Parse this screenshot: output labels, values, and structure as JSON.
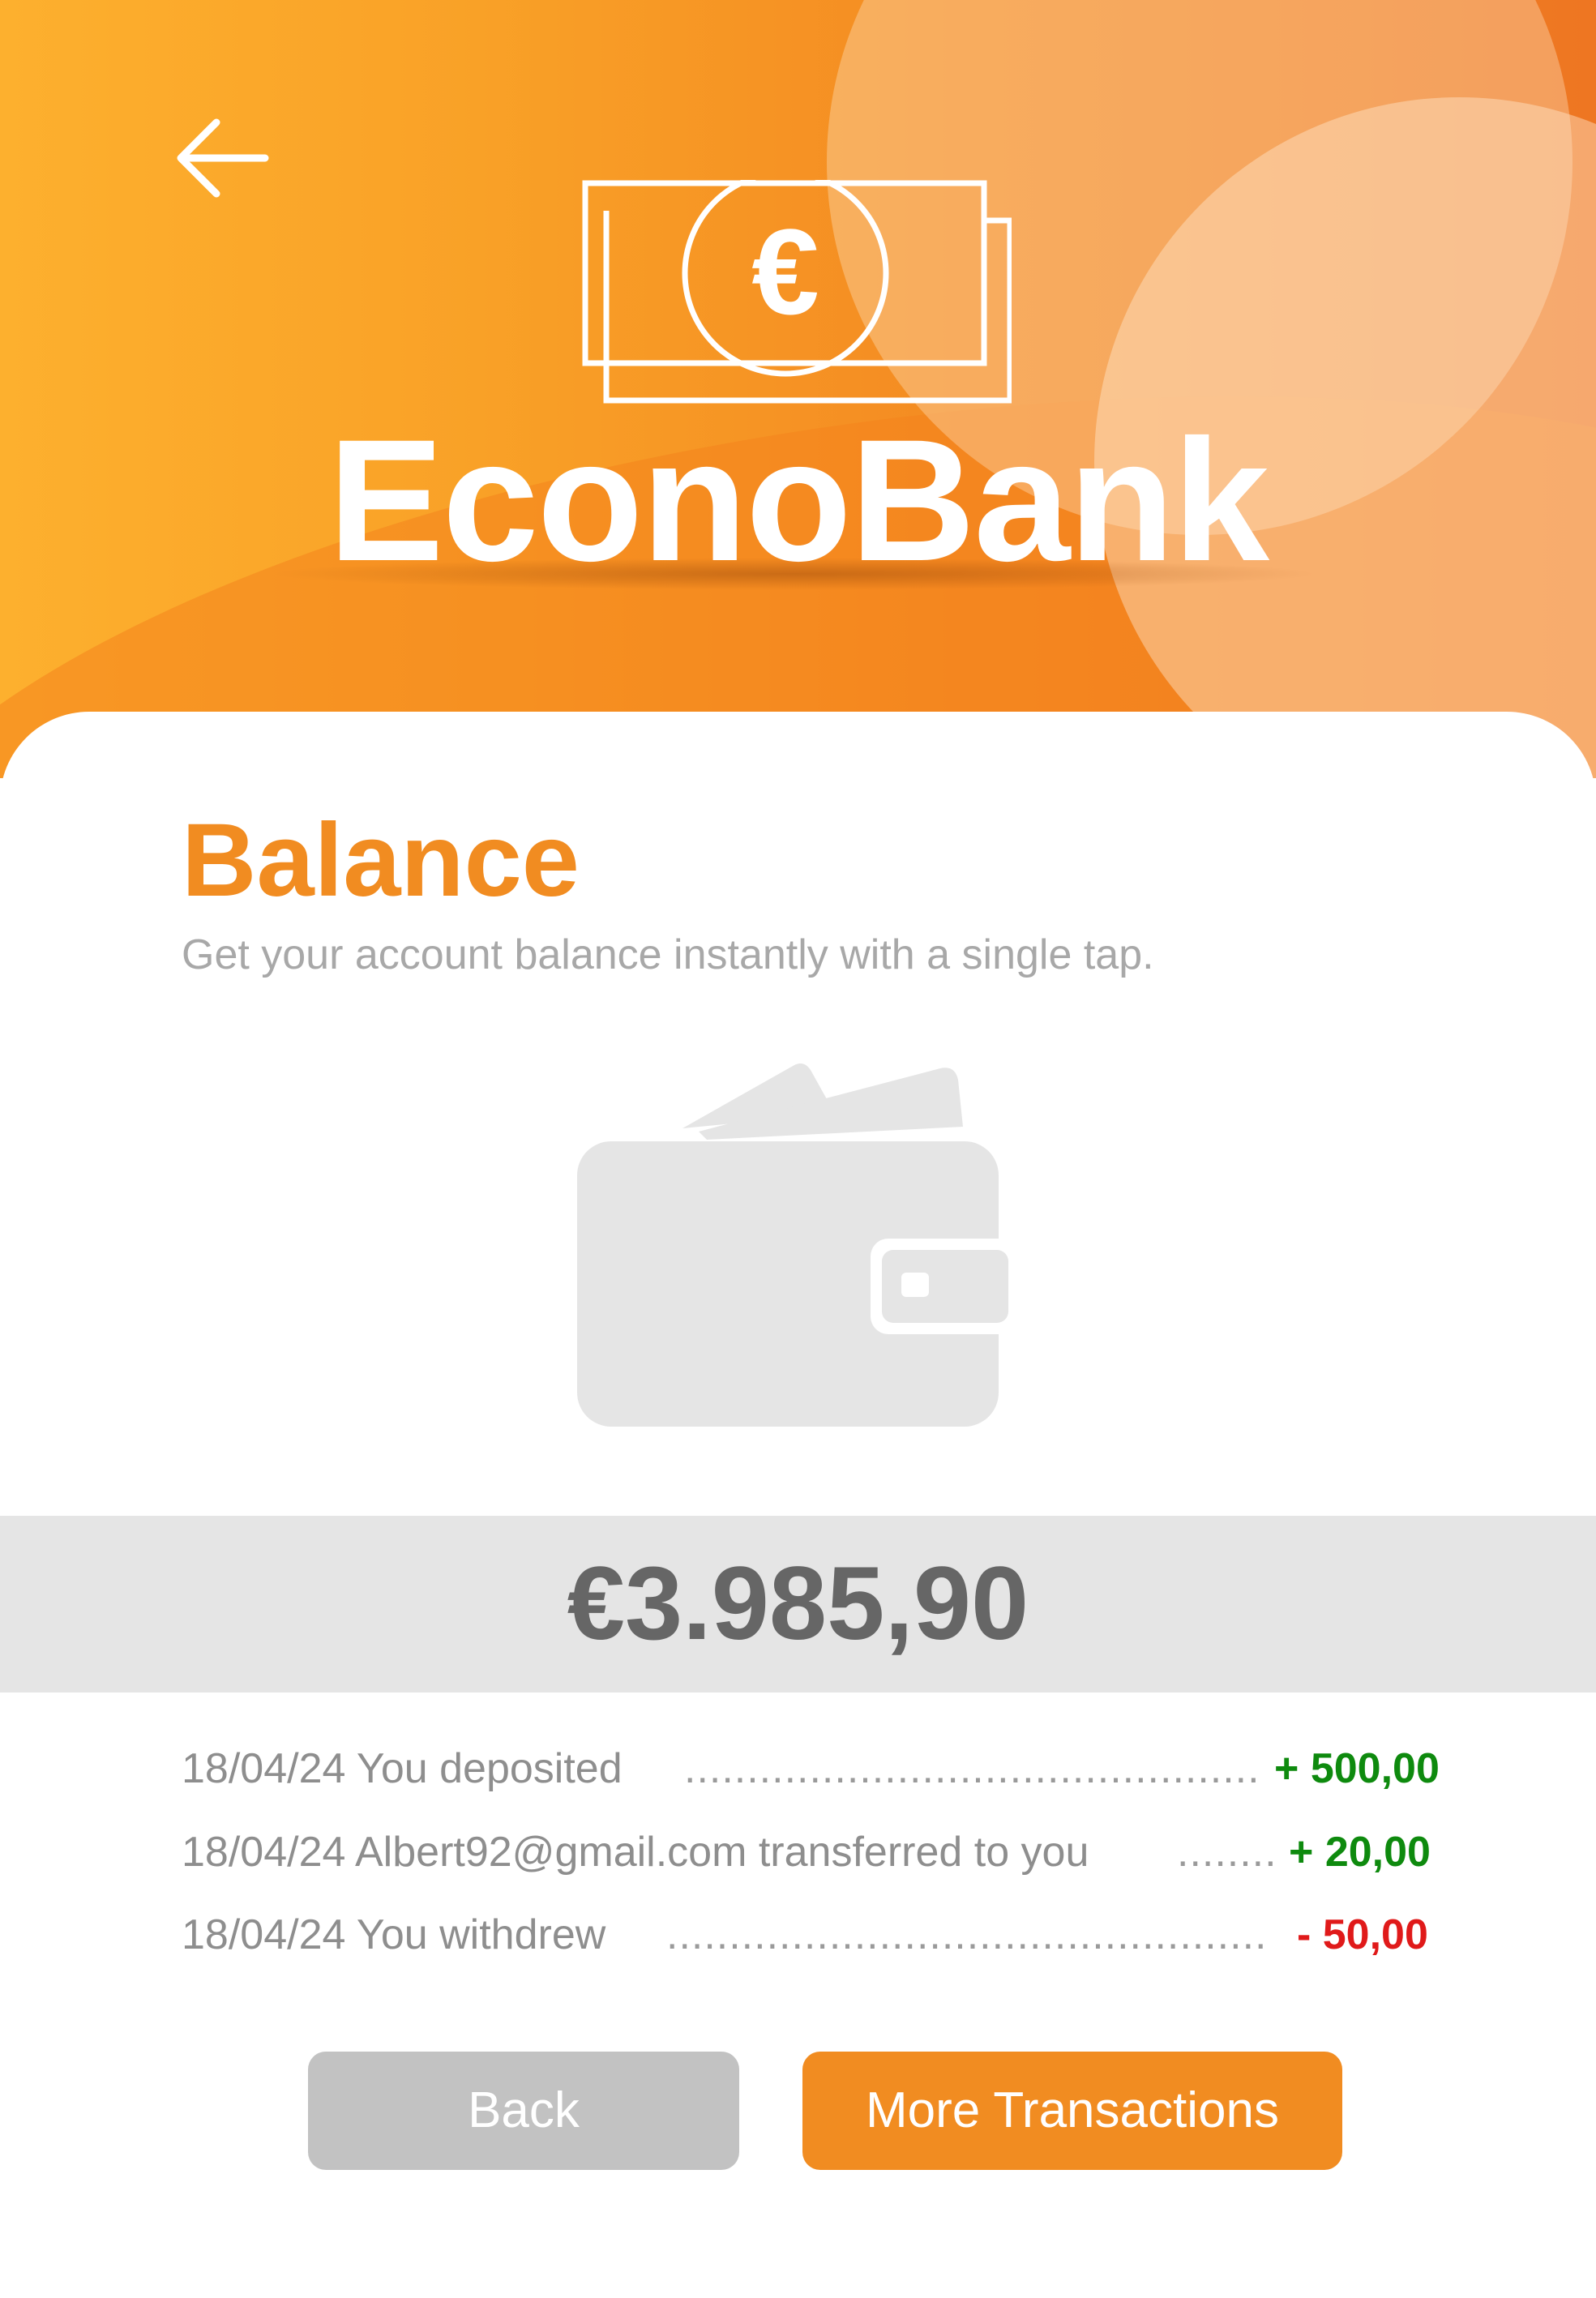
{
  "header": {
    "brand": "EconoBank",
    "back_icon": "arrow-left-icon",
    "logo_icon": "euro-banknote-icon",
    "colors": {
      "gradient_start": "#fdb02e",
      "gradient_end": "#ee7622"
    }
  },
  "balance": {
    "title": "Balance",
    "subtitle": "Get your account balance instantly with a single tap.",
    "illustration_icon": "wallet-icon",
    "amount": "€3.985,90"
  },
  "transactions": [
    {
      "description": "18/04/24 You deposited",
      "leader": "..............................................",
      "amount": "+ 500,00",
      "type": "credit"
    },
    {
      "description": "18/04/24 Albert92@gmail.com transferred to you",
      "leader": "........",
      "amount": "+ 20,00",
      "type": "credit"
    },
    {
      "description": "18/04/24 You withdrew",
      "leader": "................................................",
      "amount": "- 50,00",
      "type": "debit"
    }
  ],
  "buttons": {
    "back_label": "Back",
    "more_label": "More Transactions"
  },
  "colors": {
    "accent": "#f18c21",
    "credit": "#0e8a0e",
    "debit": "#e01a1a",
    "muted_text": "#a8a8a8",
    "balance_bar": "#e5e5e5"
  }
}
